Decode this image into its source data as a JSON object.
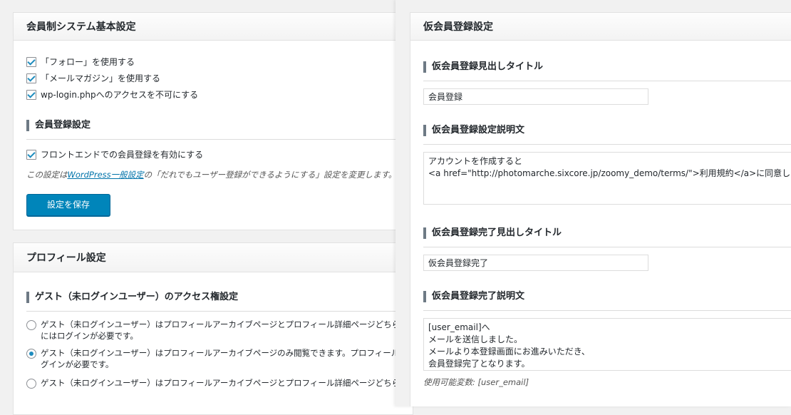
{
  "basic_settings": {
    "title": "会員制システム基本設定",
    "options": [
      {
        "label": "「フォロー」を使用する",
        "checked": true
      },
      {
        "label": "「メールマガジン」を使用する",
        "checked": true
      },
      {
        "label": "wp-login.phpへのアクセスを不可にする",
        "checked": true
      }
    ],
    "registration": {
      "title": "会員登録設定",
      "option": {
        "label": "フロントエンドでの会員登録を有効にする",
        "checked": true
      },
      "note_before": "この設定は",
      "note_link": "WordPress一般設定",
      "note_after": "の「だれでもユーザー登録ができるようにする」設定を変更します。"
    },
    "save_label": "設定を保存"
  },
  "profile_settings": {
    "title": "プロフィール設定",
    "guest_access": {
      "title": "ゲスト（未ログインユーザー）のアクセス権設定",
      "options": [
        {
          "line1": "ゲスト（未ログインユーザー）はプロフィールアーカイブページとプロフィール詳細ページどちら",
          "line2": "にはログインが必要です。",
          "checked": false
        },
        {
          "line1": "ゲスト（未ログインユーザー）はプロフィールアーカイブページのみ閲覧できます。プロフィール",
          "line2": "グインが必要です。",
          "checked": true
        },
        {
          "line1": "ゲスト（未ログインユーザー）はプロフィールアーカイブページとプロフィール詳細ページどちら",
          "line2": "",
          "checked": false
        }
      ]
    }
  },
  "provisional": {
    "title": "仮会員登録設定",
    "heading": {
      "title": "仮会員登録見出しタイトル",
      "value": "会員登録"
    },
    "description": {
      "title": "仮会員登録設定説明文",
      "value": "アカウントを作成すると\n<a href=\"http://photomarche.sixcore.jp/zoomy_demo/terms/\">利用規約</a>に同意した"
    },
    "complete_heading": {
      "title": "仮会員登録完了見出しタイトル",
      "value": "仮会員登録完了"
    },
    "complete_description": {
      "title": "仮会員登録完了説明文",
      "value": "[user_email]へ\nメールを送信しました。\nメールより本登録画面にお進みいただき、\n会員登録完了となります。"
    },
    "variables_note": "使用可能変数: [user_email]"
  },
  "colors": {
    "accent": "#0085ba",
    "link": "#0073aa",
    "check": "#1e8cbe"
  }
}
